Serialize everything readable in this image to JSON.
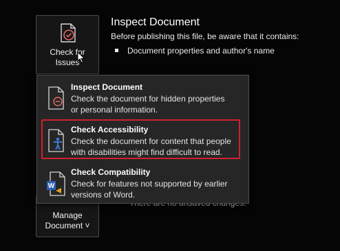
{
  "inspect_panel": {
    "heading": "Inspect Document",
    "subtext": "Before publishing this file, be aware that it contains:",
    "bullets": [
      "Document properties and author's name"
    ],
    "hidden_line": "There are no unsaved changes."
  },
  "check_tile": {
    "line1": "Check for",
    "line2": "Issues"
  },
  "manage_tile": {
    "line1": "Manage",
    "line2": "Document ˅"
  },
  "menu": {
    "items": [
      {
        "title": "Inspect Document",
        "desc1": "Check the document for hidden properties",
        "desc2": "or personal information.",
        "icon": "inspect-document-icon"
      },
      {
        "title": "Check Accessibility",
        "desc1": "Check the document for content that people",
        "desc2": "with disabilities might find difficult to read.",
        "icon": "accessibility-icon"
      },
      {
        "title": "Check Compatibility",
        "desc1": "Check for features not supported by earlier",
        "desc2": "versions of Word.",
        "icon": "compatibility-icon"
      }
    ]
  },
  "colors": {
    "highlight": "#d1202f",
    "accessibility_figure": "#3b7ddd",
    "word_blue": "#2b5fb3"
  }
}
